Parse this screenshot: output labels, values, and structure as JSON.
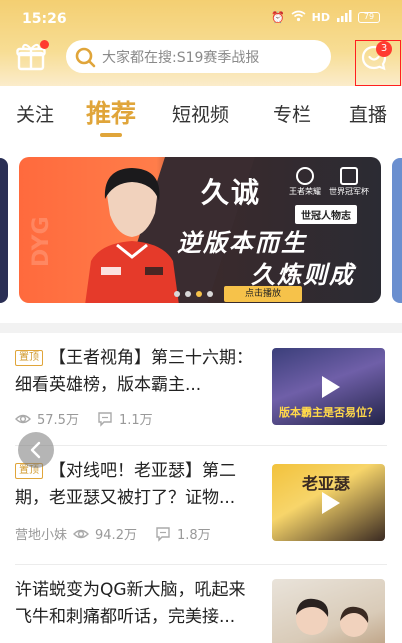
{
  "status_bar": {
    "time": "15:26",
    "network": "HD",
    "signal": "4G",
    "battery": "79"
  },
  "search": {
    "placeholder": "大家都在搜:S19赛季战报"
  },
  "messages": {
    "badge": "3"
  },
  "tabs": [
    {
      "label": "关注",
      "active": false
    },
    {
      "label": "推荐",
      "active": true
    },
    {
      "label": "短视频",
      "active": false
    },
    {
      "label": "专栏",
      "active": false
    },
    {
      "label": "直播",
      "active": false
    }
  ],
  "banner": {
    "title": "久诚",
    "tag": "世冠人物志",
    "line1": "逆版本而生",
    "line2": "久炼则成",
    "button": "点击播放",
    "logo1": "王者荣耀",
    "logo2": "世界冠军杯",
    "side_text": "DYG",
    "dots": 4,
    "active_dot": 2
  },
  "feed": [
    {
      "pinned": true,
      "pin_label": "置顶",
      "title": "【王者视角】第三十六期：细看英雄榜，版本霸主...",
      "author": "",
      "views": "57.5万",
      "comments": "1.1万",
      "thumb_text": "版本霸主是否易位？"
    },
    {
      "pinned": true,
      "pin_label": "置顶",
      "title": "【对线吧！老亚瑟】第二期，老亚瑟又被打了？证物...",
      "author": "营地小妹",
      "views": "94.2万",
      "comments": "1.8万",
      "thumb_text": "老亚瑟"
    },
    {
      "pinned": false,
      "title": "许诺蜕变为QG新大脑，吼起来飞牛和刺痛都听话，完美接...",
      "author": "",
      "views": "",
      "comments": "",
      "thumb_text": ""
    }
  ],
  "colors": {
    "accent": "#e0a53a",
    "badge": "#ff3b30",
    "header_top": "#f4cf72"
  }
}
